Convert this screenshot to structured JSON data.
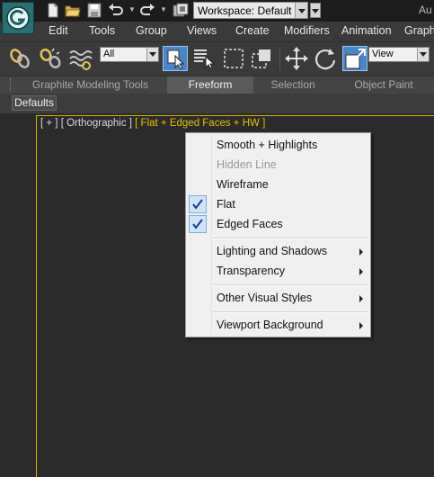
{
  "quick_access": {
    "workspace_label": "Workspace: Default",
    "title_partial": "Au"
  },
  "menubar": {
    "items": [
      "Edit",
      "Tools",
      "Group",
      "Views",
      "Create",
      "Modifiers",
      "Animation",
      "Graph"
    ]
  },
  "toolbar": {
    "selection_filter": "All",
    "ref_coord_system": "View"
  },
  "ribbon": {
    "tabs": [
      "Graphite Modeling Tools",
      "Freeform",
      "Selection",
      "Object Paint"
    ],
    "active_tab": "Freeform",
    "panel_button": "Defaults"
  },
  "viewport": {
    "label_plus": "[ + ]",
    "label_view": "[ Orthographic ]",
    "label_shading": "[ Flat + Edged Faces + HW ]"
  },
  "context_menu": {
    "items": [
      {
        "label": "Smooth + Highlights",
        "checked": false,
        "disabled": false,
        "submenu": false
      },
      {
        "label": "Hidden Line",
        "checked": false,
        "disabled": true,
        "submenu": false
      },
      {
        "label": "Wireframe",
        "checked": false,
        "disabled": false,
        "submenu": false
      },
      {
        "label": "Flat",
        "checked": true,
        "disabled": false,
        "submenu": false
      },
      {
        "label": "Edged Faces",
        "checked": true,
        "disabled": false,
        "submenu": false
      },
      {
        "label": "Lighting and Shadows",
        "checked": false,
        "disabled": false,
        "submenu": true
      },
      {
        "label": "Transparency",
        "checked": false,
        "disabled": false,
        "submenu": true
      },
      {
        "label": "Other Visual Styles",
        "checked": false,
        "disabled": false,
        "submenu": true
      },
      {
        "label": "Viewport Background",
        "checked": false,
        "disabled": false,
        "submenu": true
      }
    ]
  },
  "colors": {
    "viewport_border": "#d4b000",
    "check_highlight": "#cfe4fa",
    "app_button": "#2a6f72"
  }
}
